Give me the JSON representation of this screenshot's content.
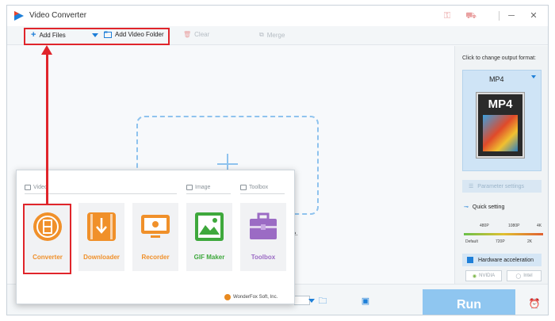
{
  "app": {
    "title": "Video Converter",
    "icons": [
      "app-logo",
      "key-icon",
      "cart-icon"
    ],
    "window_controls": [
      "minimize",
      "close"
    ]
  },
  "toolbar": {
    "add_files": "Add Files",
    "add_video_folder": "Add Video Folder",
    "clear": "Clear",
    "merge": "Merge"
  },
  "drop_zone": {
    "hint_fragment": "e."
  },
  "right_panel": {
    "output_label": "Click to change output format:",
    "format_name": "MP4",
    "format_icon_text": "MP4",
    "parameter_settings": "Parameter settings",
    "quick_setting": "Quick setting",
    "ticks_top": [
      "480P",
      "1080P",
      "4K"
    ],
    "ticks_bottom": [
      "Default",
      "720P",
      "2K"
    ],
    "hardware_acceleration": "Hardware acceleration",
    "chips": [
      "NVIDIA",
      "Intel"
    ]
  },
  "bottom_bar": {
    "run": "Run"
  },
  "launcher": {
    "sections": [
      "Video",
      "Image",
      "Toolbox"
    ],
    "tiles": [
      {
        "label": "Converter",
        "color": "#f0902a"
      },
      {
        "label": "Downloader",
        "color": "#f0902a"
      },
      {
        "label": "Recorder",
        "color": "#f0902a"
      },
      {
        "label": "GIF Maker",
        "color": "#3ea83c"
      },
      {
        "label": "Toolbox",
        "color": "#9b6bc4"
      }
    ],
    "credit": "WonderFox Soft, Inc."
  },
  "annotation_color": "#e0252b"
}
